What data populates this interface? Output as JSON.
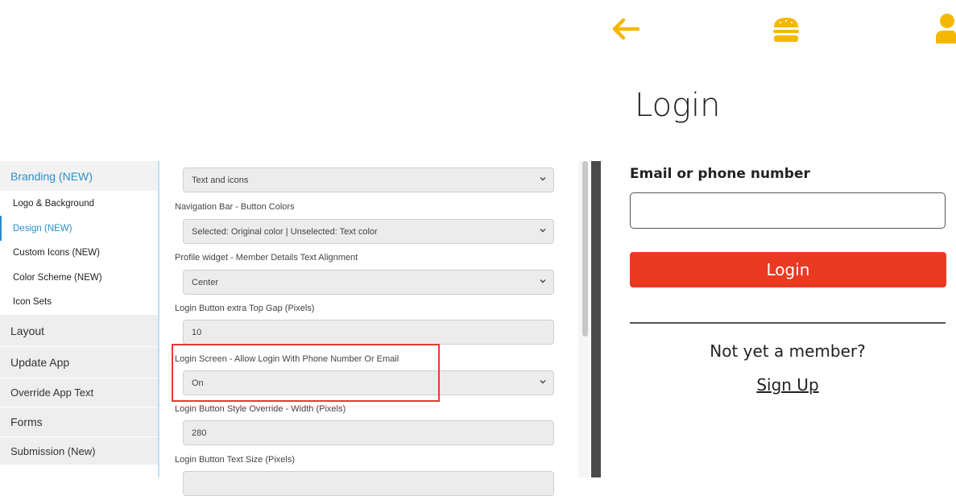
{
  "sidebar": {
    "branding": "Branding (NEW)",
    "items": [
      {
        "label": "Logo & Background"
      },
      {
        "label": "Design (NEW)"
      },
      {
        "label": "Custom Icons (NEW)"
      },
      {
        "label": "Color Scheme (NEW)"
      },
      {
        "label": "Icon Sets"
      }
    ],
    "sections": [
      {
        "label": "Layout"
      },
      {
        "label": "Update App"
      },
      {
        "label": "Override App Text"
      },
      {
        "label": "Forms"
      },
      {
        "label": "Submission (New)"
      }
    ]
  },
  "form": {
    "top_select_value": "Text and icons",
    "fields": [
      {
        "label": "Navigation Bar - Button Colors",
        "value": "Selected: Original color | Unselected: Text color",
        "type": "select"
      },
      {
        "label": "Profile widget - Member Details Text Alignment",
        "value": "Center",
        "type": "select"
      },
      {
        "label": "Login Button extra Top Gap (Pixels)",
        "value": "10",
        "type": "text"
      },
      {
        "label": "Login Screen - Allow Login With Phone Number Or Email",
        "value": "On",
        "type": "select"
      },
      {
        "label": "Login Button Style Override - Width (Pixels)",
        "value": "280",
        "type": "text"
      },
      {
        "label": "Login Button Text Size (Pixels)",
        "value": "",
        "type": "text"
      }
    ]
  },
  "preview": {
    "title": "Login",
    "email_label": "Email or phone number",
    "email_value": "",
    "login_button": "Login",
    "not_member": "Not yet a member?",
    "signup": "Sign Up",
    "icons": [
      "back-arrow-icon",
      "burger-menu-icon",
      "user-icon"
    ],
    "accent_color": "#f5b800",
    "button_color": "#ea3a22",
    "highlight_color": "#e53b2f"
  }
}
